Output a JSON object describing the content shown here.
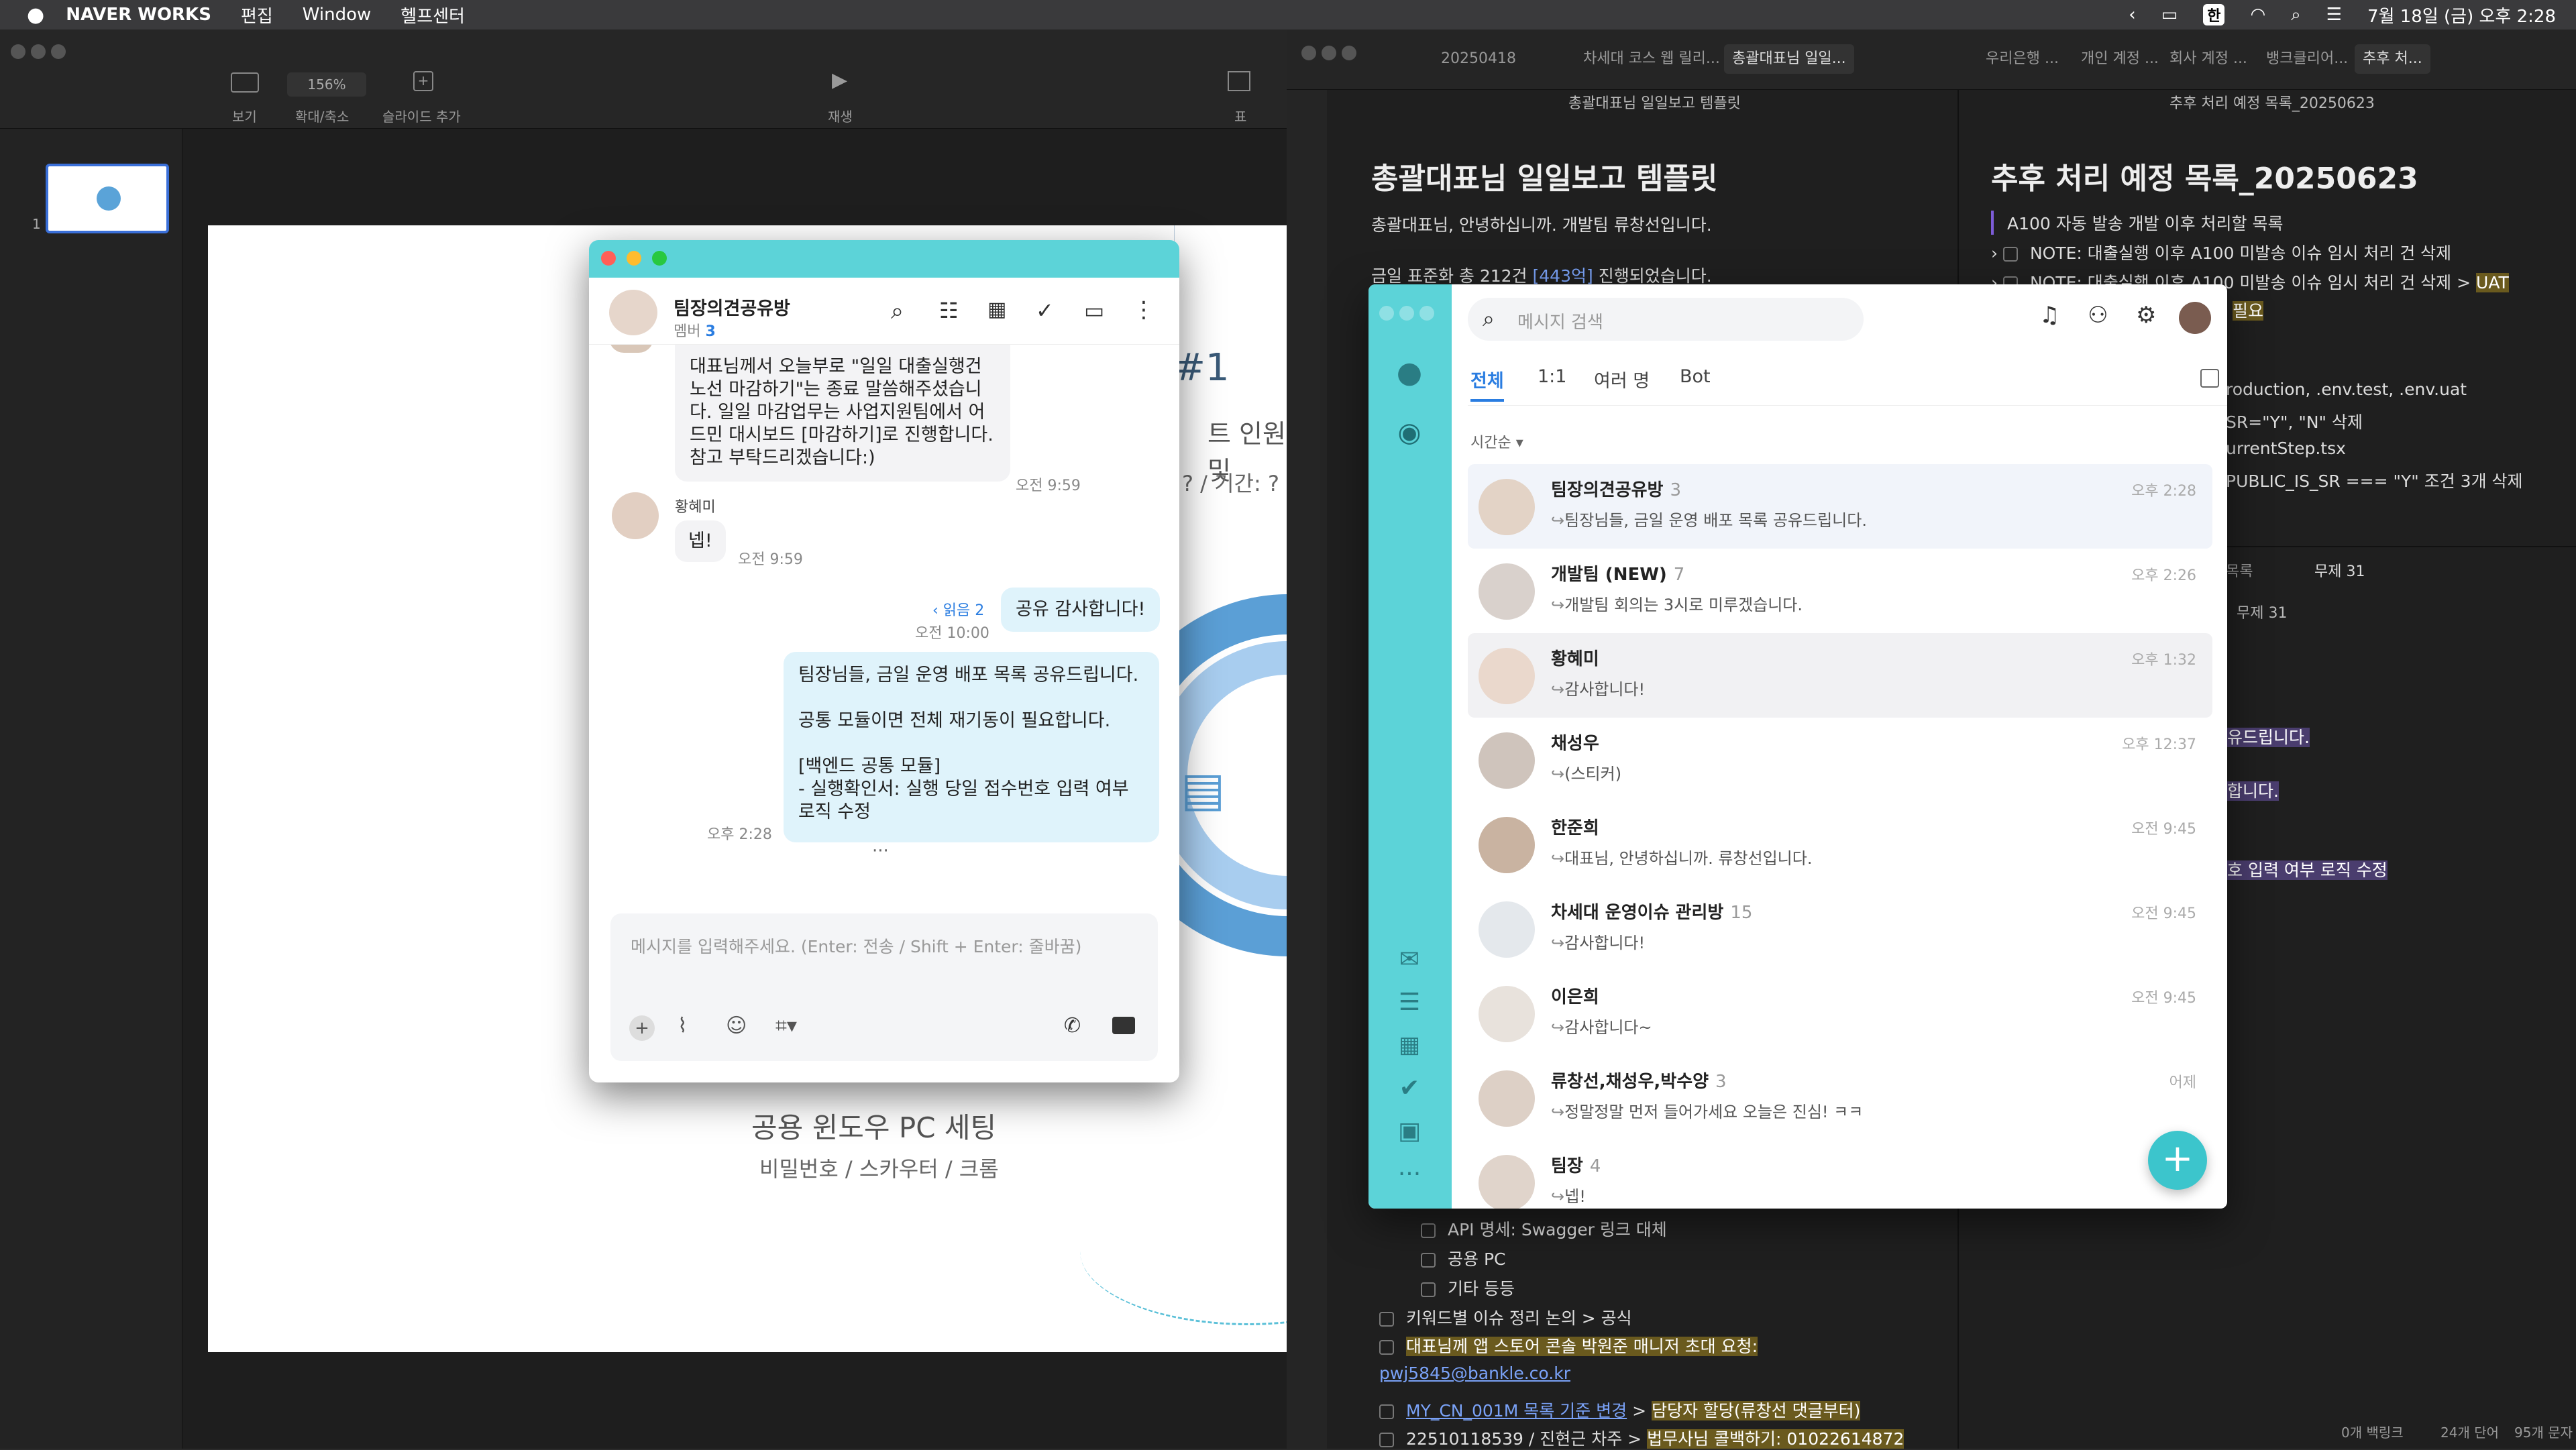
{
  "menubar": {
    "app": "NAVER WORKS",
    "items": [
      "편집",
      "Window",
      "헬프센터"
    ],
    "ime": "한",
    "datetime": "7월 18일 (금) 오후 2:28"
  },
  "keynote": {
    "zoom": "156%",
    "tools": [
      "보기",
      "확대/축소",
      "슬라이드 추가",
      "재생",
      "표"
    ],
    "slide_num": "1",
    "slide": {
      "hash": "#1",
      "partial": "트 인원 및",
      "partial2": "? / 기간: ?",
      "title": "공용 윈도우 PC 세팅",
      "subtitle": "비밀번호 / 스카우터 / 크롬"
    }
  },
  "chat": {
    "room": "팀장의견공유방",
    "members_label": "멤버",
    "members": "3",
    "msgs": [
      {
        "text": "대표님께서 오늘부로 \"일일 대출실행건 노선 마감하기\"는 종료 말씀해주셨습니다. 일일 마감업무는 사업지원팀에서 어드민 대시보드 [마감하기]로 진행합니다. 참고 부탁드리겠습니다:)",
        "time": "오전 9:59"
      },
      {
        "sender": "황혜미",
        "text": "넵!",
        "time": "오전 9:59"
      },
      {
        "read": "‹ 읽음 2",
        "text": "공유 감사합니다!",
        "time": "오전 10:00"
      },
      {
        "l1": "팀장님들, 금일 운영 배포 목록 공유드립니다.",
        "l2": "공통 모듈이면 전체 재기동이 필요합니다.",
        "l3": "[백엔드 공통 모듈]",
        "l4": "- 실행확인서: 실행 당일 접수번호 입력 여부 로직 수정",
        "time": "오후 2:28"
      }
    ],
    "placeholder": "메시지를 입력해주세요. (Enter: 전송 / Shift + Enter: 줄바꿈)",
    "more": "···"
  },
  "note1": {
    "tabs": [
      "20250418",
      "차세대 코스 웹 릴리...",
      "총괄대표님 일일..."
    ],
    "header": "총괄대표님 일일보고 템플릿",
    "title": "총괄대표님 일일보고 템플릿",
    "line1": "총괄대표님, 안녕하십니까. 개발팀 류창선입니다.",
    "line2a": "금일 표준화 총 212건 ",
    "line2b": "[443억]",
    "line2c": " 진행되었습니다.",
    "items": [
      "API 명세: Swagger 링크 대체",
      "공용 PC",
      "기타 등등"
    ],
    "b1": "키워드별 이슈 정리 논의 > 공식",
    "b2a": "대표님께 앱 스토어 콘솔 박원준 매니저 초대 요청: ",
    "b2b": "pwj5845@bankle.co.kr",
    "b3a": "MY_CN_001M 목록 기준 변경",
    "b3b": " > ",
    "b3c": "담당자 할당(류창선 댓글부터)",
    "b4a": "22510118539 / 진현근 차주 > ",
    "b4b": "법무사님 콜백하기: 01022614872"
  },
  "note2": {
    "tabs": [
      "우리은행 ...",
      "개인 계정 ...",
      "회사 계정 ...",
      "뱅크클리어...",
      "추후 처..."
    ],
    "header": "추후 처리 예정 목록_20250623",
    "title": "추후 처리 예정 목록_20250623",
    "quote": "A100 자동 발송 개발 이후 처리할 목록",
    "n1": "NOTE: 대출실행 이후 A100 미발송 이슈 임시 처리 건 삭제",
    "n2": "NOTE: 대출실행 이후 A100 미발송 이슈 임시 처리 건 삭제 > ",
    "n2b": "UAT",
    "n3": "필요",
    "f1": "roduction, .env.test, .env.uat",
    "f2": "SR=\"Y\", \"N\" 삭제",
    "f3": "urrentStep.tsx",
    "f4": "PUBLIC_IS_SR === \"Y\" 조건 3개 삭제",
    "tab2": "무제 31",
    "tab1": "목록",
    "header2": "무제 31",
    "p1": "유드립니다.",
    "p2": "합니다.",
    "p3": "호 입력 여부 로직 수정",
    "status": [
      "0개 백링크",
      "24개 단어",
      "95개 문자"
    ]
  },
  "works": {
    "search_placeholder": "메시지 검색",
    "tabs": [
      "전체",
      "1:1",
      "여러 명",
      "Bot"
    ],
    "sort": "시간순",
    "rooms": [
      {
        "name": "팀장의견공유방",
        "count": "3",
        "preview": "팀장님들, 금일 운영 배포 목록 공유드립니다.",
        "time": "오후 2:28"
      },
      {
        "name": "개발팀 (NEW)",
        "count": "7",
        "preview": "개발팀 회의는 3시로 미루겠습니다.",
        "time": "오후 2:26"
      },
      {
        "name": "황혜미",
        "count": "",
        "preview": "감사합니다!",
        "time": "오후 1:32"
      },
      {
        "name": "채성우",
        "count": "",
        "preview": "(스티커)",
        "time": "오후 12:37"
      },
      {
        "name": "한준희",
        "count": "",
        "preview": "대표님, 안녕하십니까. 류창선입니다.",
        "time": "오전 9:45"
      },
      {
        "name": "차세대 운영이슈 관리방",
        "count": "15",
        "preview": "감사합니다!",
        "time": "오전 9:45"
      },
      {
        "name": "이은희",
        "count": "",
        "preview": "감사합니다~",
        "time": "오전 9:45"
      },
      {
        "name": "류창선,채성우,박수양",
        "count": "3",
        "preview": "정말정말 먼저 들어가세요 오늘은 진심! ㅋㅋ",
        "time": "어제"
      },
      {
        "name": "팀장",
        "count": "4",
        "preview": "넵!",
        "time": ""
      }
    ]
  }
}
